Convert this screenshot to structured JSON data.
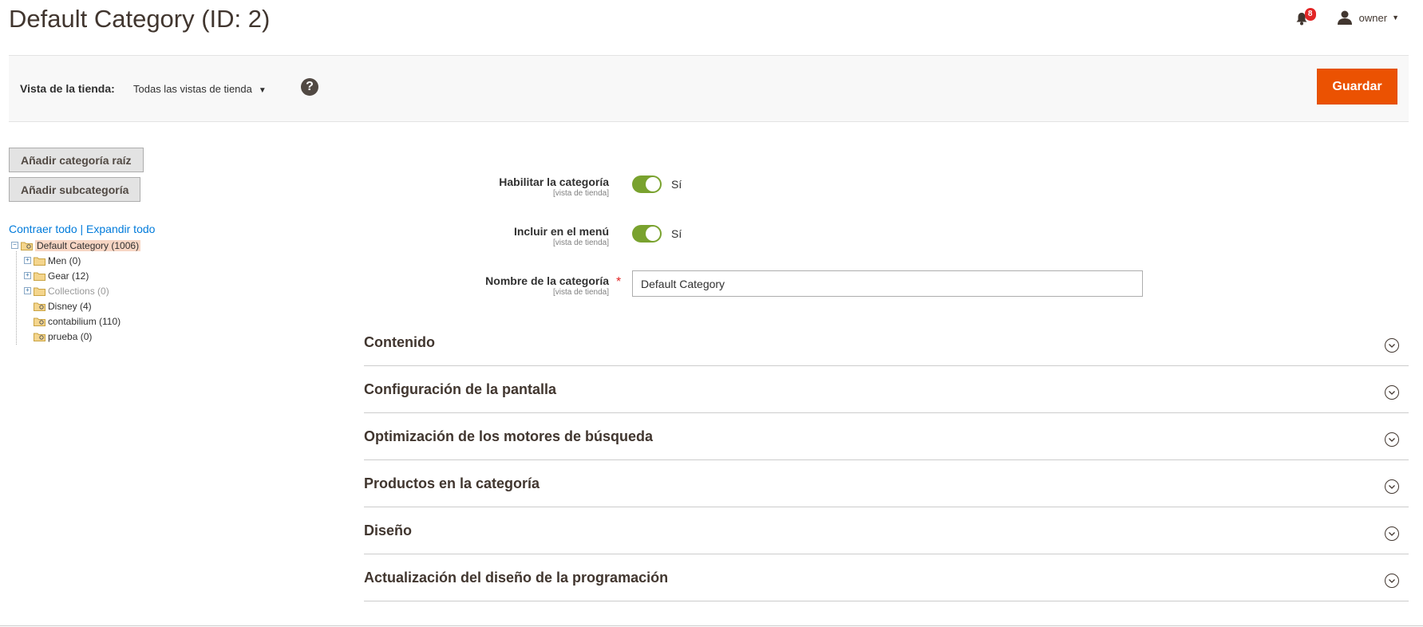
{
  "header": {
    "title": "Default Category (ID: 2)",
    "notifications_count": "8",
    "user_name": "owner"
  },
  "scope": {
    "label": "Vista de la tienda:",
    "value": "Todas las vistas de tienda",
    "save_label": "Guardar"
  },
  "sidebar": {
    "add_root_label": "Añadir categoría raíz",
    "add_sub_label": "Añadir subcategoría",
    "collapse_all": "Contraer todo",
    "separator": "|",
    "expand_all": "Expandir todo",
    "tree": [
      {
        "label": "Default Category (1006)",
        "state": "selected"
      },
      {
        "label": "Men (0)"
      },
      {
        "label": "Gear (12)"
      },
      {
        "label": "Collections (0)",
        "state": "disabled"
      },
      {
        "label": "Disney (4)"
      },
      {
        "label": "contabilium (110)"
      },
      {
        "label": "prueba (0)"
      }
    ]
  },
  "form": {
    "enable": {
      "label": "Habilitar la categoría",
      "scope": "[vista de tienda]",
      "value": "Sí"
    },
    "menu": {
      "label": "Incluir en el menú",
      "scope": "[vista de tienda]",
      "value": "Sí"
    },
    "name": {
      "label": "Nombre de la categoría",
      "scope": "[vista de tienda]",
      "value": "Default Category",
      "required_mark": "*"
    }
  },
  "sections": [
    "Contenido",
    "Configuración de la pantalla",
    "Optimización de los motores de búsqueda",
    "Productos en la categoría",
    "Diseño",
    "Actualización del diseño de la programación"
  ],
  "colors": {
    "accent": "#eb5202",
    "toggle_on": "#79a22e",
    "link": "#007bdb",
    "badge": "#e22626"
  },
  "icons": [
    "bell-icon",
    "user-icon",
    "help-icon",
    "folder-icon",
    "chevron-down-icon"
  ]
}
